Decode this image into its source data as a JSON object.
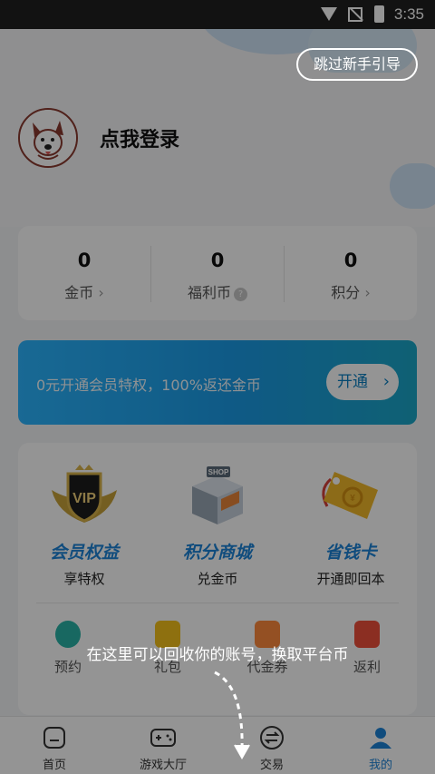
{
  "status_bar": {
    "time": "3:35"
  },
  "guide": {
    "skip_label": "跳过新手引导",
    "tip_text": "在这里可以回收你的账号，换取平台币"
  },
  "profile": {
    "login_label": "点我登录"
  },
  "stats": [
    {
      "value": "0",
      "label": "金币",
      "suffix": "›"
    },
    {
      "value": "0",
      "label": "福利币",
      "suffix": "?"
    },
    {
      "value": "0",
      "label": "积分",
      "suffix": "›"
    }
  ],
  "vip_banner": {
    "text": "0元开通会员特权，100%返还金币",
    "button": "开通"
  },
  "features": [
    {
      "title": "会员权益",
      "subtitle": "享特权",
      "icon": "vip-badge-icon"
    },
    {
      "title": "积分商城",
      "subtitle": "兑金币",
      "icon": "shop-icon"
    },
    {
      "title": "省钱卡",
      "subtitle": "开通即回本",
      "icon": "coupon-card-icon"
    }
  ],
  "shortcuts": [
    {
      "label": "预约",
      "icon": "alarm-clock-icon",
      "color": "#2ab3a8"
    },
    {
      "label": "礼包",
      "icon": "gift-icon",
      "color": "#f5c21b"
    },
    {
      "label": "代金券",
      "icon": "voucher-icon",
      "color": "#ff8a3d"
    },
    {
      "label": "返利",
      "icon": "rebate-icon",
      "color": "#f0503c"
    }
  ],
  "tabs": [
    {
      "label": "首页",
      "icon": "home-icon"
    },
    {
      "label": "游戏大厅",
      "icon": "gamepad-icon"
    },
    {
      "label": "交易",
      "icon": "exchange-icon"
    },
    {
      "label": "我的",
      "icon": "user-icon",
      "active": true
    }
  ],
  "colors": {
    "accent": "#1d84d8",
    "banner_start": "#2bb5ff",
    "banner_end": "#1aa7c8"
  }
}
